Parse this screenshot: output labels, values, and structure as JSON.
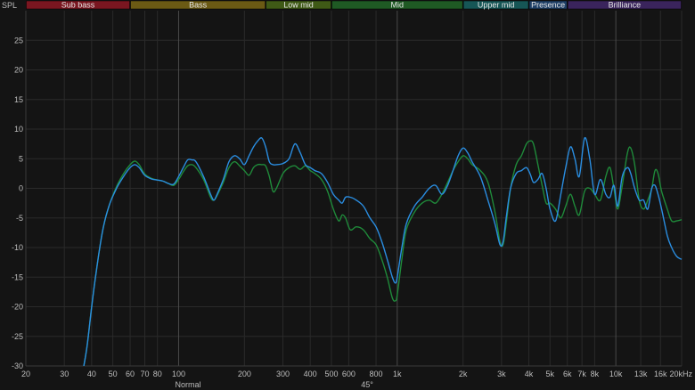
{
  "chart_data": {
    "type": "line",
    "ylabel": "SPL",
    "x_scale": "log",
    "xlim": [
      20,
      20000
    ],
    "ylim": [
      -30,
      30
    ],
    "y_ticks": [
      -30,
      -25,
      -20,
      -15,
      -10,
      -5,
      0,
      5,
      10,
      15,
      20,
      25
    ],
    "x_ticks": [
      {
        "v": 20,
        "t": "20",
        "major": false
      },
      {
        "v": 30,
        "t": "30",
        "major": false
      },
      {
        "v": 40,
        "t": "40",
        "major": false
      },
      {
        "v": 50,
        "t": "50",
        "major": false
      },
      {
        "v": 60,
        "t": "60",
        "major": false
      },
      {
        "v": 70,
        "t": "70",
        "major": false
      },
      {
        "v": 80,
        "t": "80",
        "major": false
      },
      {
        "v": 100,
        "t": "100",
        "major": true
      },
      {
        "v": 200,
        "t": "200",
        "major": false
      },
      {
        "v": 300,
        "t": "300",
        "major": false
      },
      {
        "v": 400,
        "t": "400",
        "major": false
      },
      {
        "v": 500,
        "t": "500",
        "major": false
      },
      {
        "v": 600,
        "t": "600",
        "major": false
      },
      {
        "v": 800,
        "t": "800",
        "major": false
      },
      {
        "v": 1000,
        "t": "1k",
        "major": true
      },
      {
        "v": 2000,
        "t": "2k",
        "major": false
      },
      {
        "v": 3000,
        "t": "3k",
        "major": false
      },
      {
        "v": 4000,
        "t": "4k",
        "major": false
      },
      {
        "v": 5000,
        "t": "5k",
        "major": false
      },
      {
        "v": 6000,
        "t": "6k",
        "major": false
      },
      {
        "v": 7000,
        "t": "7k",
        "major": false
      },
      {
        "v": 8000,
        "t": "8k",
        "major": false
      },
      {
        "v": 10000,
        "t": "10k",
        "major": true
      },
      {
        "v": 13000,
        "t": "13k",
        "major": false,
        "dim": true
      },
      {
        "v": 16000,
        "t": "16k",
        "major": false
      },
      {
        "v": 20000,
        "t": "20kHz",
        "major": false
      }
    ],
    "bands": [
      {
        "name": "Sub bass",
        "from": 20,
        "to": 60,
        "color": "#7a1620"
      },
      {
        "name": "Bass",
        "from": 60,
        "to": 250,
        "color": "#6b5a14"
      },
      {
        "name": "Low mid",
        "from": 250,
        "to": 500,
        "color": "#3f5a16"
      },
      {
        "name": "Mid",
        "from": 500,
        "to": 2000,
        "color": "#1f5a24"
      },
      {
        "name": "Upper mid",
        "from": 2000,
        "to": 4000,
        "color": "#165656"
      },
      {
        "name": "Presence",
        "from": 4000,
        "to": 6000,
        "color": "#1e3f66"
      },
      {
        "name": "Brilliance",
        "from": 6000,
        "to": 20000,
        "color": "#3a245c"
      }
    ],
    "series": [
      {
        "name": "Normal",
        "color": "#1f8a3a",
        "points": [
          [
            36,
            -32
          ],
          [
            38,
            -27
          ],
          [
            40,
            -20
          ],
          [
            42,
            -14
          ],
          [
            45,
            -7
          ],
          [
            48,
            -3
          ],
          [
            52,
            0.3
          ],
          [
            56,
            2.5
          ],
          [
            60,
            4
          ],
          [
            63,
            4.6
          ],
          [
            66,
            4
          ],
          [
            70,
            2.4
          ],
          [
            75,
            1.7
          ],
          [
            80,
            1.4
          ],
          [
            85,
            1.2
          ],
          [
            90,
            0.8
          ],
          [
            95,
            0.5
          ],
          [
            100,
            1.5
          ],
          [
            105,
            2.8
          ],
          [
            110,
            3.8
          ],
          [
            115,
            4
          ],
          [
            120,
            3.5
          ],
          [
            130,
            1.5
          ],
          [
            140,
            -1.5
          ],
          [
            145,
            -2
          ],
          [
            150,
            -1.2
          ],
          [
            160,
            1
          ],
          [
            170,
            3.5
          ],
          [
            180,
            4.5
          ],
          [
            190,
            3.8
          ],
          [
            200,
            3
          ],
          [
            210,
            2.2
          ],
          [
            220,
            3.5
          ],
          [
            230,
            4
          ],
          [
            240,
            4
          ],
          [
            250,
            3.8
          ],
          [
            260,
            2
          ],
          [
            270,
            -0.5
          ],
          [
            280,
            0
          ],
          [
            300,
            2.5
          ],
          [
            320,
            3.5
          ],
          [
            340,
            3.8
          ],
          [
            360,
            3.2
          ],
          [
            380,
            3.8
          ],
          [
            400,
            3
          ],
          [
            420,
            2.5
          ],
          [
            450,
            1.5
          ],
          [
            480,
            -0.5
          ],
          [
            510,
            -3.5
          ],
          [
            540,
            -5.5
          ],
          [
            560,
            -4.5
          ],
          [
            580,
            -5
          ],
          [
            610,
            -7
          ],
          [
            650,
            -6.5
          ],
          [
            700,
            -7
          ],
          [
            750,
            -8.5
          ],
          [
            800,
            -9.5
          ],
          [
            850,
            -12
          ],
          [
            900,
            -15
          ],
          [
            950,
            -18.5
          ],
          [
            980,
            -19
          ],
          [
            1000,
            -18
          ],
          [
            1050,
            -12
          ],
          [
            1100,
            -7
          ],
          [
            1200,
            -4
          ],
          [
            1300,
            -2.5
          ],
          [
            1400,
            -2
          ],
          [
            1500,
            -2.5
          ],
          [
            1600,
            -1
          ],
          [
            1700,
            1
          ],
          [
            1800,
            3
          ],
          [
            1900,
            4.5
          ],
          [
            2000,
            5.5
          ],
          [
            2100,
            5
          ],
          [
            2200,
            4
          ],
          [
            2400,
            3
          ],
          [
            2600,
            1
          ],
          [
            2800,
            -4
          ],
          [
            2950,
            -9
          ],
          [
            3050,
            -9.5
          ],
          [
            3150,
            -6
          ],
          [
            3300,
            0
          ],
          [
            3500,
            4
          ],
          [
            3700,
            5.5
          ],
          [
            3900,
            7.5
          ],
          [
            4050,
            8
          ],
          [
            4200,
            7.5
          ],
          [
            4400,
            4
          ],
          [
            4600,
            0.5
          ],
          [
            4800,
            -2.5
          ],
          [
            5000,
            -2.5
          ],
          [
            5300,
            -3.5
          ],
          [
            5600,
            -5
          ],
          [
            5900,
            -3
          ],
          [
            6200,
            -1
          ],
          [
            6500,
            -3
          ],
          [
            6800,
            -4.5
          ],
          [
            7200,
            -0.5
          ],
          [
            7600,
            0
          ],
          [
            8000,
            -1
          ],
          [
            8500,
            -2
          ],
          [
            9000,
            2
          ],
          [
            9400,
            3.5
          ],
          [
            9800,
            0
          ],
          [
            10200,
            -3.5
          ],
          [
            10700,
            0.5
          ],
          [
            11300,
            6
          ],
          [
            11700,
            6.8
          ],
          [
            12200,
            4
          ],
          [
            12800,
            -2
          ],
          [
            13400,
            -3.5
          ],
          [
            14000,
            -2
          ],
          [
            14600,
            0
          ],
          [
            15100,
            3
          ],
          [
            15600,
            2.5
          ],
          [
            16200,
            -0.5
          ],
          [
            17200,
            -3.5
          ],
          [
            18000,
            -5.5
          ],
          [
            19000,
            -5.5
          ],
          [
            20000,
            -5.3
          ]
        ]
      },
      {
        "name": "45°",
        "color": "#2a8de0",
        "points": [
          [
            36,
            -32
          ],
          [
            38,
            -27
          ],
          [
            40,
            -20
          ],
          [
            42,
            -14
          ],
          [
            45,
            -7
          ],
          [
            48,
            -3
          ],
          [
            52,
            0
          ],
          [
            56,
            2
          ],
          [
            60,
            3.5
          ],
          [
            63,
            4
          ],
          [
            66,
            3.5
          ],
          [
            70,
            2.2
          ],
          [
            75,
            1.6
          ],
          [
            80,
            1.4
          ],
          [
            85,
            1.2
          ],
          [
            90,
            0.8
          ],
          [
            95,
            0.7
          ],
          [
            100,
            2
          ],
          [
            105,
            3.5
          ],
          [
            110,
            4.8
          ],
          [
            115,
            4.8
          ],
          [
            120,
            4.5
          ],
          [
            130,
            2
          ],
          [
            140,
            -1
          ],
          [
            145,
            -2
          ],
          [
            150,
            -1
          ],
          [
            160,
            1.5
          ],
          [
            170,
            4.5
          ],
          [
            180,
            5.5
          ],
          [
            190,
            5
          ],
          [
            200,
            4
          ],
          [
            210,
            5.5
          ],
          [
            220,
            7
          ],
          [
            230,
            8
          ],
          [
            240,
            8.5
          ],
          [
            250,
            7
          ],
          [
            260,
            4.5
          ],
          [
            270,
            4
          ],
          [
            280,
            4
          ],
          [
            300,
            4.2
          ],
          [
            320,
            5
          ],
          [
            340,
            7.5
          ],
          [
            360,
            6
          ],
          [
            380,
            4
          ],
          [
            400,
            3.5
          ],
          [
            420,
            3
          ],
          [
            450,
            2.5
          ],
          [
            480,
            1
          ],
          [
            510,
            -1
          ],
          [
            540,
            -2
          ],
          [
            560,
            -2.5
          ],
          [
            580,
            -1.5
          ],
          [
            610,
            -1.5
          ],
          [
            650,
            -2
          ],
          [
            700,
            -3
          ],
          [
            750,
            -5
          ],
          [
            800,
            -6.5
          ],
          [
            850,
            -9
          ],
          [
            900,
            -12
          ],
          [
            950,
            -15
          ],
          [
            980,
            -16
          ],
          [
            1000,
            -15
          ],
          [
            1050,
            -10
          ],
          [
            1100,
            -6
          ],
          [
            1200,
            -3
          ],
          [
            1300,
            -1.5
          ],
          [
            1400,
            0
          ],
          [
            1500,
            0.5
          ],
          [
            1600,
            -1
          ],
          [
            1700,
            0.5
          ],
          [
            1800,
            3
          ],
          [
            1900,
            5.5
          ],
          [
            2000,
            6.8
          ],
          [
            2100,
            6
          ],
          [
            2200,
            4.5
          ],
          [
            2400,
            2
          ],
          [
            2600,
            -2
          ],
          [
            2800,
            -6
          ],
          [
            2950,
            -9.5
          ],
          [
            3050,
            -9
          ],
          [
            3150,
            -5
          ],
          [
            3300,
            0
          ],
          [
            3500,
            2.5
          ],
          [
            3700,
            3
          ],
          [
            3900,
            3.5
          ],
          [
            4050,
            2.5
          ],
          [
            4200,
            1
          ],
          [
            4400,
            1.5
          ],
          [
            4600,
            2.5
          ],
          [
            4800,
            0
          ],
          [
            5000,
            -3.5
          ],
          [
            5300,
            -5.5
          ],
          [
            5600,
            -1
          ],
          [
            5900,
            3.5
          ],
          [
            6200,
            7
          ],
          [
            6500,
            5
          ],
          [
            6800,
            2
          ],
          [
            7200,
            8.5
          ],
          [
            7600,
            5
          ],
          [
            8000,
            -1
          ],
          [
            8500,
            1.5
          ],
          [
            9000,
            -1
          ],
          [
            9400,
            -1.5
          ],
          [
            9800,
            0.5
          ],
          [
            10200,
            -3
          ],
          [
            10700,
            2
          ],
          [
            11300,
            3.5
          ],
          [
            11700,
            2.5
          ],
          [
            12200,
            0
          ],
          [
            12800,
            -2
          ],
          [
            13400,
            -2
          ],
          [
            14000,
            -3.5
          ],
          [
            14600,
            0
          ],
          [
            15100,
            0.5
          ],
          [
            15600,
            -1
          ],
          [
            16200,
            -3.5
          ],
          [
            17200,
            -8
          ],
          [
            18000,
            -10
          ],
          [
            19000,
            -11.5
          ],
          [
            20000,
            -12
          ]
        ]
      }
    ]
  }
}
